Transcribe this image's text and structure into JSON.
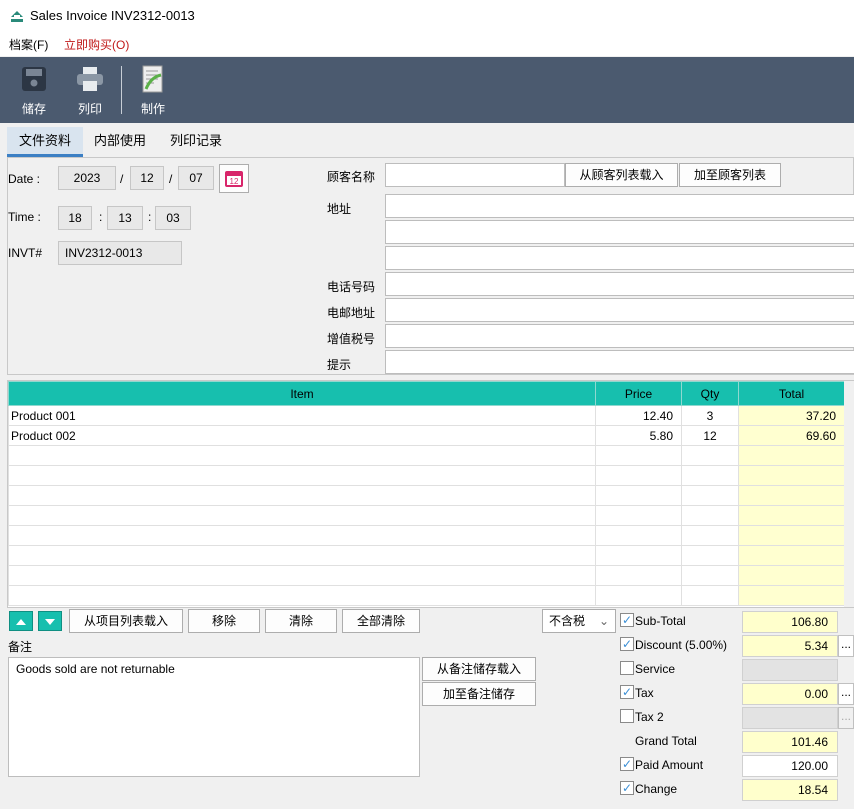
{
  "window": {
    "title": "Sales Invoice INV2312-0013"
  },
  "menu": {
    "file": "档案(F)",
    "buy": "立即购买(O)"
  },
  "toolbar": {
    "save": "储存",
    "print": "列印",
    "make": "制作"
  },
  "tabs": [
    {
      "label": "文件资料",
      "active": true
    },
    {
      "label": "内部使用"
    },
    {
      "label": "列印记录"
    }
  ],
  "form": {
    "date_label": "Date :",
    "year": "2023",
    "month": "12",
    "day": "07",
    "date_sep": "/",
    "time_label": "Time :",
    "hour": "18",
    "minute": "13",
    "second": "03",
    "time_sep": ":",
    "invt_label": "INVT#",
    "invt": "INV2312-0013",
    "customer_label": "顾客名称",
    "customer": "",
    "load_customer": "从顾客列表载入",
    "add_customer": "加至顾客列表",
    "address_label": "地址",
    "phone_label": "电话号码",
    "email_label": "电邮地址",
    "vat_label": "增值税号",
    "note_label": "提示"
  },
  "grid": {
    "headers": [
      "Item",
      "Price",
      "Qty",
      "Total"
    ],
    "rows": [
      {
        "item": "Product 001",
        "price": "12.40",
        "qty": "3",
        "total": "37.20"
      },
      {
        "item": "Product 002",
        "price": "5.80",
        "qty": "12",
        "total": "69.60"
      }
    ],
    "accent": "#17bfae"
  },
  "actions": {
    "load_items": "从项目列表载入",
    "remove": "移除",
    "clear": "清除",
    "clear_all": "全部清除",
    "tax_mode": "不含税"
  },
  "remarks": {
    "label": "备注",
    "text": "Goods sold are not returnable",
    "load": "从备注储存载入",
    "save": "加至备注储存"
  },
  "totals": [
    {
      "label": "Sub-Total",
      "value": "106.80",
      "checked": true,
      "checkbox": true
    },
    {
      "label": "Discount (5.00%)",
      "value": "5.34",
      "checked": true,
      "checkbox": true,
      "more": "..."
    },
    {
      "label": "Service",
      "value": "",
      "checked": false,
      "checkbox": true,
      "disabled": true
    },
    {
      "label": "Tax",
      "value": "0.00",
      "checked": true,
      "checkbox": true,
      "more": "..."
    },
    {
      "label": "Tax 2",
      "value": "",
      "checked": false,
      "checkbox": true,
      "disabled": true,
      "more": "..."
    },
    {
      "label": "Grand Total",
      "value": "101.46",
      "checkbox": false
    },
    {
      "label": "Paid Amount",
      "value": "120.00",
      "checked": true,
      "checkbox": true,
      "editable": true
    },
    {
      "label": "Change",
      "value": "18.54",
      "checked": true,
      "checkbox": true
    }
  ]
}
